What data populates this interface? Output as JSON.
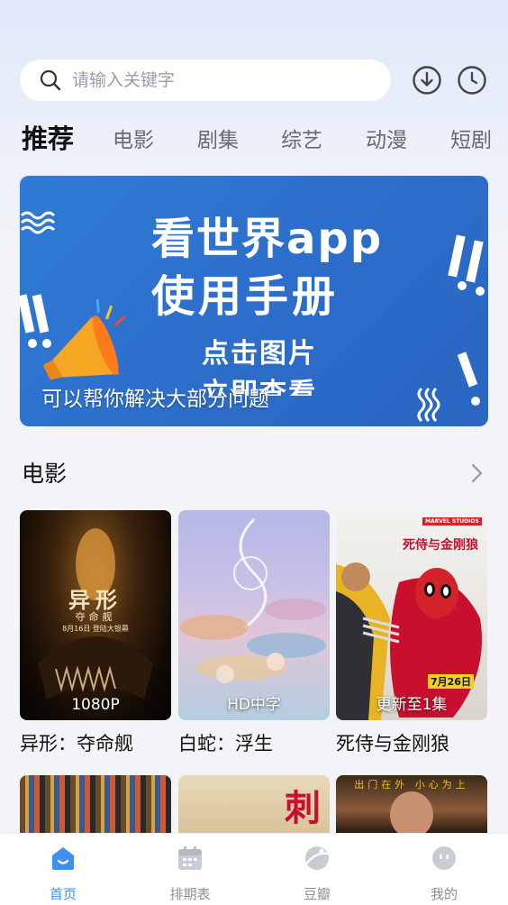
{
  "search": {
    "placeholder": "请输入关键字"
  },
  "header_icons": [
    "download-icon",
    "history-clock-icon"
  ],
  "tabs": [
    {
      "label": "推荐",
      "active": true
    },
    {
      "label": "电影"
    },
    {
      "label": "剧集"
    },
    {
      "label": "综艺"
    },
    {
      "label": "动漫"
    },
    {
      "label": "短剧"
    }
  ],
  "banner": {
    "title_line1": "看世界app",
    "title_line2": "使用手册",
    "sub_line1": "点击图片",
    "sub_line2": "立即查看",
    "caption": "可以帮你解决大部分问题"
  },
  "section": {
    "title": "电影",
    "more_icon": "chevron-right-icon"
  },
  "movies": [
    {
      "title": "异形：夺命舰",
      "badge": "1080P",
      "poster_text": "异形",
      "poster_sub": "夺命舰",
      "poster_date": "8月16日 登陆大银幕"
    },
    {
      "title": "白蛇：浮生",
      "badge": "HD中字"
    },
    {
      "title": "死侍与金刚狼",
      "badge": "更新至1集",
      "poster_text": "死侍与金刚狼",
      "poster_brand": "MARVEL STUDIOS",
      "poster_date": "7月26日"
    },
    {
      "title": "",
      "badge": ""
    },
    {
      "title": "",
      "badge": "",
      "poster_text": "刺"
    },
    {
      "title": "",
      "badge": "",
      "poster_text": "出门在外 小心为上"
    }
  ],
  "bottom_nav": [
    {
      "label": "首页",
      "icon": "home-icon",
      "active": true
    },
    {
      "label": "排期表",
      "icon": "calendar-icon"
    },
    {
      "label": "豆瓣",
      "icon": "planet-icon"
    },
    {
      "label": "我的",
      "icon": "profile-face-icon"
    }
  ],
  "colors": {
    "accent": "#3c8ff5",
    "banner_blue": "#2f7bd6",
    "nav_inactive": "#8a8f98"
  }
}
